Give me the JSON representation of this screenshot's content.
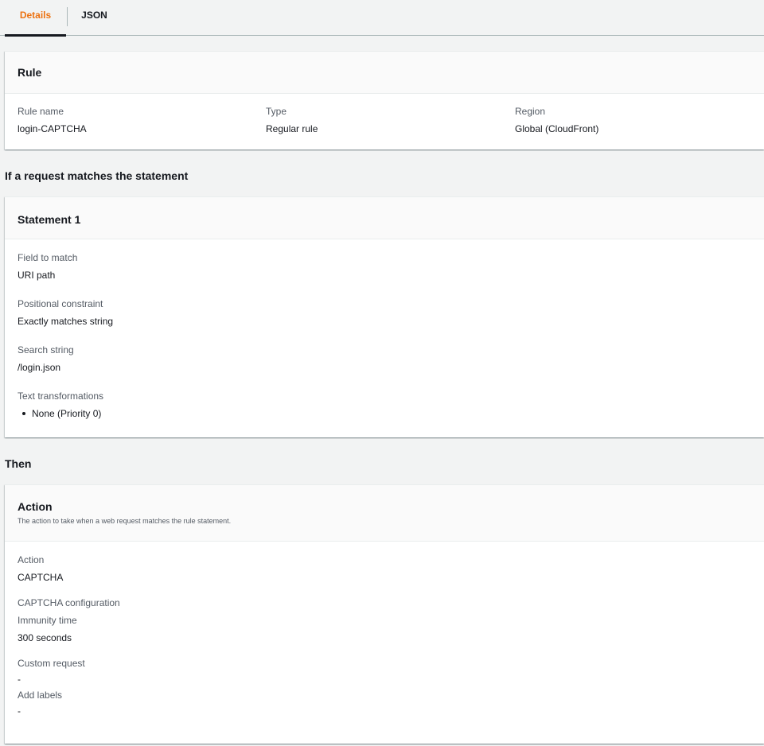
{
  "tabs": [
    {
      "label": "Details",
      "active": true
    },
    {
      "label": "JSON",
      "active": false
    }
  ],
  "rule_card": {
    "title": "Rule",
    "fields": [
      {
        "label": "Rule name",
        "value": "login-CAPTCHA"
      },
      {
        "label": "Type",
        "value": "Regular rule"
      },
      {
        "label": "Region",
        "value": "Global (CloudFront)"
      }
    ]
  },
  "statement_section": {
    "heading": "If a request matches the statement",
    "card_title": "Statement 1",
    "fields": [
      {
        "label": "Field to match",
        "value": "URI path"
      },
      {
        "label": "Positional constraint",
        "value": "Exactly matches string"
      },
      {
        "label": "Search string",
        "value": "/login.json"
      },
      {
        "label": "Text transformations",
        "items": [
          "None (Priority 0)"
        ]
      }
    ]
  },
  "then_section": {
    "heading": "Then",
    "card_title": "Action",
    "card_description": "The action to take when a web request matches the rule statement.",
    "action_label": "Action",
    "action_value": "CAPTCHA",
    "captcha_config_label": "CAPTCHA configuration",
    "immunity_label": "Immunity time",
    "immunity_value": "300 seconds",
    "custom_request_label": "Custom request",
    "custom_request_value": "-",
    "add_labels_label": "Add labels",
    "add_labels_value": "-"
  },
  "colors": {
    "accent": "#ec7211",
    "background": "#f2f3f3",
    "text": "#16191f",
    "secondary_text": "#545b64"
  }
}
